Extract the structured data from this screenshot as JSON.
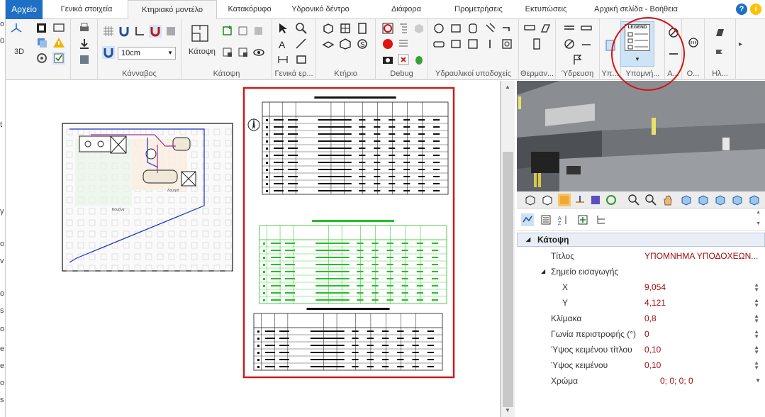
{
  "tabs": [
    {
      "label": "Αρχείο",
      "type": "file"
    },
    {
      "label": "Γενικά στοιχεία"
    },
    {
      "label": "Κτηριακό μοντέλο",
      "active": true
    },
    {
      "label": "Κατακόρυφο"
    },
    {
      "label": "Υδρονικό δέντρο"
    },
    {
      "label": "Διάφορα"
    },
    {
      "label": "Προμετρήσεις"
    },
    {
      "label": "Εκτυπώσεις"
    },
    {
      "label": "Αρχική σελίδα - Βοήθεια"
    }
  ],
  "ribbon": {
    "groups": [
      {
        "label": "Κάνναβος"
      },
      {
        "label": "Κάτοψη"
      },
      {
        "label": "Γενικά ερ..."
      },
      {
        "label": "Κτήριο"
      },
      {
        "label": "Debug"
      },
      {
        "label": "Υδραυλικοί υποδοχείς"
      },
      {
        "label": "Θερμαν..."
      },
      {
        "label": "Ύδρευση"
      },
      {
        "label": "Υπ..."
      },
      {
        "label": "Υπομνή..."
      },
      {
        "label": "Α..."
      },
      {
        "label": "Ο..."
      },
      {
        "label": "Ηλ..."
      }
    ],
    "grid_size": "10cm",
    "floor_plan_label": "Κάτοψη",
    "view_3d_label": "3D",
    "legend_icon_text": "LEGEND"
  },
  "colors": {
    "file_tab": "#1f6fc5",
    "highlight_red": "#d41414",
    "legend_green": "#22c322",
    "pipe_blue": "#1b2fc8",
    "pipe_purple": "#a0308f",
    "value_red": "#a01010"
  },
  "drawing": {
    "room_label_1": "Κουζίνα",
    "room_label_2": "Λουτρό"
  },
  "properties": {
    "section": "Κάτοψη",
    "rows": [
      {
        "name": "Τίτλος",
        "value": "ΥΠΟΜΝΗΜΑ ΥΠΟΔΟΧΕΩΝ..."
      },
      {
        "name": "Σημείο εισαγωγής",
        "value": "",
        "expandable": true
      },
      {
        "name": "X",
        "value": "9,054",
        "indent": true,
        "spin": true
      },
      {
        "name": "Y",
        "value": "4,121",
        "indent": true,
        "spin": true
      },
      {
        "name": "Κλίμακα",
        "value": "0,8",
        "spin": true
      },
      {
        "name": "Γωνία περιστροφής (°)",
        "value": "0",
        "spin": true
      },
      {
        "name": "Ύψος κειμένου τίτλου",
        "value": "0,10",
        "spin": true
      },
      {
        "name": "Ύψος κειμένου",
        "value": "0,10",
        "spin": true
      },
      {
        "name": "Χρώμα",
        "value": "0; 0; 0; 0",
        "dropdown": true
      }
    ]
  },
  "left_strip": [
    "o",
    "0",
    "t",
    "γ",
    "o",
    "v",
    "o",
    "s",
    "o",
    "e",
    "e",
    "o",
    "s"
  ]
}
